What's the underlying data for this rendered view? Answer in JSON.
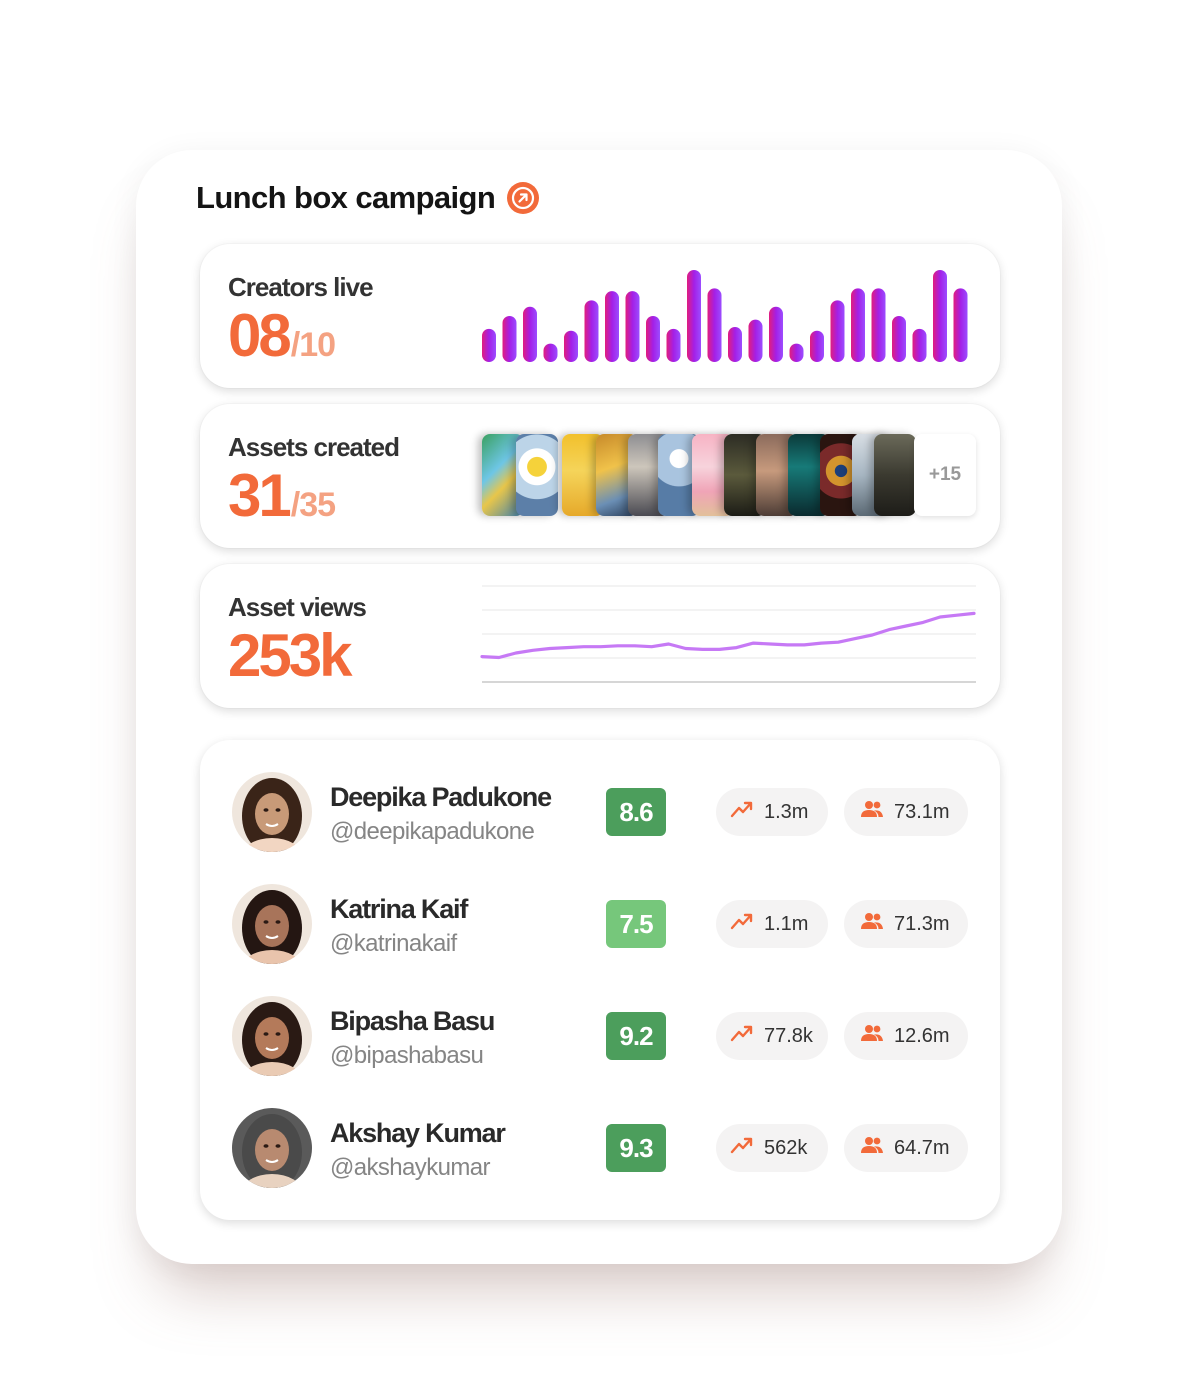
{
  "campaign": {
    "title": "Lunch box campaign",
    "open_icon": "arrow-up-right-icon",
    "accent_color": "#f26a3a"
  },
  "stats": {
    "creators_live": {
      "label": "Creators live",
      "value": "08",
      "total": "/10",
      "bar_levels": [
        0.36,
        0.5,
        0.6,
        0.2,
        0.34,
        0.67,
        0.77,
        0.77,
        0.5,
        0.36,
        1.0,
        0.8,
        0.38,
        0.46,
        0.6,
        0.2,
        0.34,
        0.67,
        0.8,
        0.8,
        0.5,
        0.36,
        1.0,
        0.8
      ],
      "bar_colors": [
        "#e11d7e",
        "#a41fe6",
        "#9b4dff"
      ]
    },
    "assets_created": {
      "label": "Assets created",
      "value": "31",
      "total": "/35",
      "more_label": "+15"
    },
    "asset_views": {
      "label": "Asset views",
      "value": "253k",
      "trend_levels": [
        0.26,
        0.25,
        0.3,
        0.33,
        0.35,
        0.36,
        0.37,
        0.37,
        0.38,
        0.38,
        0.37,
        0.4,
        0.35,
        0.34,
        0.34,
        0.36,
        0.41,
        0.4,
        0.39,
        0.39,
        0.41,
        0.42,
        0.46,
        0.5,
        0.56,
        0.6,
        0.64,
        0.7,
        0.72,
        0.74
      ],
      "line_color": "#c679f5"
    }
  },
  "creators": [
    {
      "name": "Deepika Padukone",
      "handle": "@deepikapadukone",
      "score": "8.6",
      "score_color": "#4c9e5c",
      "growth": "1.3m",
      "followers": "73.1m"
    },
    {
      "name": "Katrina Kaif",
      "handle": "@katrinakaif",
      "score": "7.5",
      "score_color": "#76c77b",
      "growth": "1.1m",
      "followers": "71.3m"
    },
    {
      "name": "Bipasha Basu",
      "handle": "@bipashabasu",
      "score": "9.2",
      "score_color": "#4c9e5c",
      "growth": "77.8k",
      "followers": "12.6m"
    },
    {
      "name": "Akshay Kumar",
      "handle": "@akshaykumar",
      "score": "9.3",
      "score_color": "#4c9e5c",
      "growth": "562k",
      "followers": "64.7m"
    }
  ],
  "icons": {
    "growth": "trending-up-icon",
    "followers": "users-icon",
    "avatar": "avatar"
  }
}
